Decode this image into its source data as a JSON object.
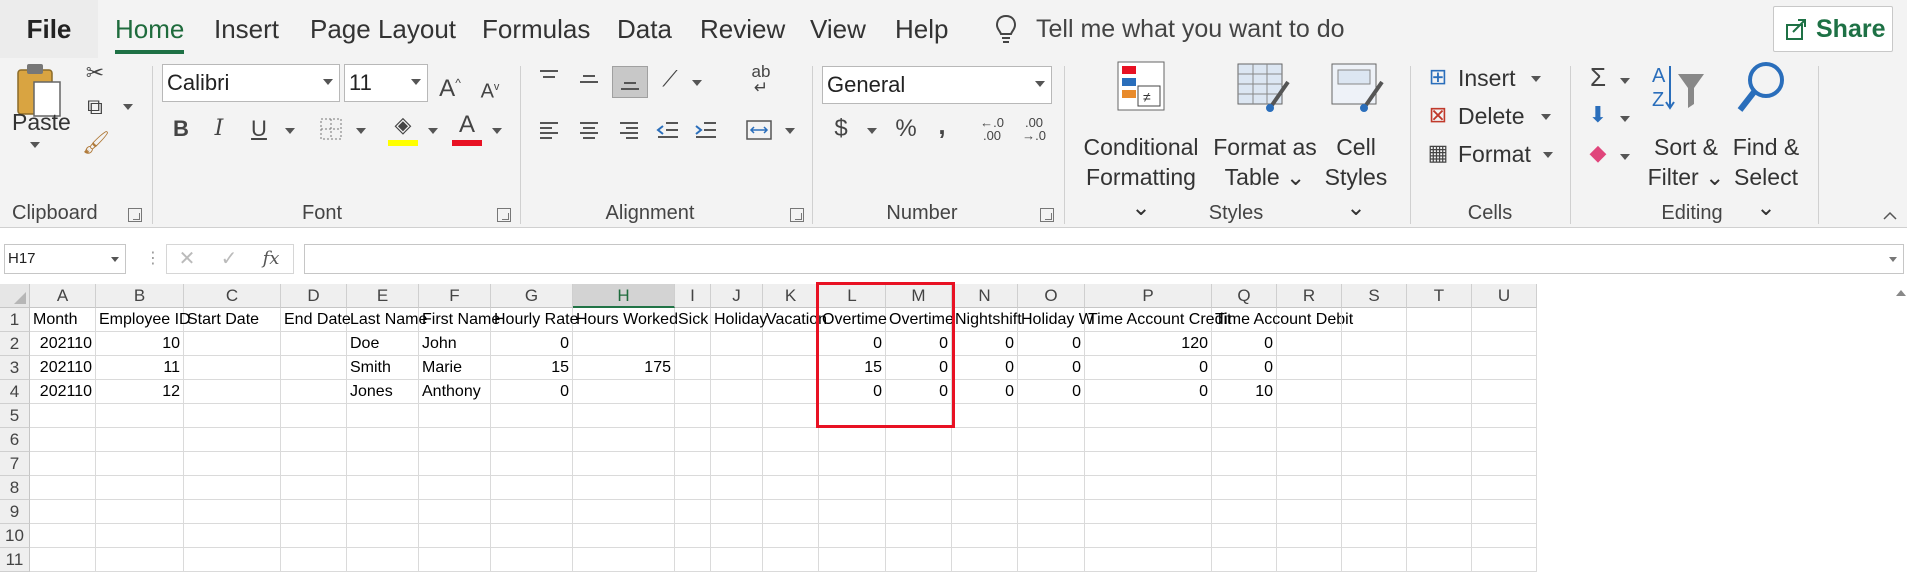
{
  "menu": {
    "file": "File",
    "tabs": [
      "Home",
      "Insert",
      "Page Layout",
      "Formulas",
      "Data",
      "Review",
      "View",
      "Help"
    ],
    "active_tab": "Home",
    "tell_me": "Tell me what you want to do",
    "share": "Share"
  },
  "ribbon": {
    "clipboard": {
      "label": "Clipboard",
      "paste": "Paste"
    },
    "font": {
      "label": "Font",
      "name": "Calibri",
      "size": "11",
      "bold": "B",
      "italic": "I",
      "underline": "U",
      "grow": "A",
      "shrink": "A",
      "font_color_letter": "A",
      "highlight_color": "#ffff00",
      "font_color": "#e81123"
    },
    "alignment": {
      "label": "Alignment",
      "wrap": "ab"
    },
    "number": {
      "label": "Number",
      "format": "General",
      "currency": "$",
      "percent": "%",
      "comma": ",",
      "inc_dec": "←.0 .00",
      "dec_dec": ".00 →.0"
    },
    "styles": {
      "label": "Styles",
      "conditional": [
        "Conditional",
        "Formatting"
      ],
      "format_table": [
        "Format as",
        "Table"
      ],
      "cell_styles": [
        "Cell",
        "Styles"
      ]
    },
    "cells": {
      "label": "Cells",
      "insert": "Insert",
      "delete": "Delete",
      "format": "Format"
    },
    "editing": {
      "label": "Editing",
      "sort": [
        "Sort &",
        "Filter"
      ],
      "find": [
        "Find &",
        "Select"
      ],
      "sigma": "Σ"
    }
  },
  "formula_bar": {
    "name_box": "H17",
    "fx": "fx",
    "cancel": "✕",
    "enter": "✓",
    "value": ""
  },
  "grid": {
    "columns": [
      "A",
      "B",
      "C",
      "D",
      "E",
      "F",
      "G",
      "H",
      "I",
      "J",
      "K",
      "L",
      "M",
      "N",
      "O",
      "P",
      "Q",
      "R",
      "S",
      "T",
      "U"
    ],
    "selected_column": "H",
    "row_numbers": [
      "1",
      "2",
      "3",
      "4",
      "5",
      "6",
      "7",
      "8",
      "9",
      "10",
      "11"
    ],
    "rows": [
      [
        "Month",
        "Employee ID",
        "Start Date",
        "End Date",
        "Last Name",
        "First Name",
        "Hourly Rate",
        "Hours Worked",
        "Sick",
        "Holiday",
        "Vacation",
        "Overtime",
        "Overtime",
        "Nightshift",
        "Holiday W",
        "Time Account Credit",
        "Time Account Debit",
        "",
        "",
        "",
        ""
      ],
      [
        "202110",
        "10",
        "",
        "",
        "Doe",
        "John",
        "0",
        "",
        "",
        "",
        "",
        "0",
        "0",
        "0",
        "0",
        "120",
        "0",
        "",
        "",
        "",
        ""
      ],
      [
        "202110",
        "11",
        "",
        "",
        "Smith",
        "Marie",
        "15",
        "175",
        "",
        "",
        "",
        "15",
        "0",
        "0",
        "0",
        "0",
        "0",
        "",
        "",
        "",
        ""
      ],
      [
        "202110",
        "12",
        "",
        "",
        "Jones",
        "Anthony",
        "0",
        "",
        "",
        "",
        "",
        "0",
        "0",
        "0",
        "0",
        "0",
        "10",
        "",
        "",
        "",
        ""
      ]
    ],
    "numeric_columns": [
      "A",
      "B",
      "G",
      "H",
      "L",
      "M",
      "N",
      "O",
      "P",
      "Q"
    ],
    "highlight_color": "#e81123"
  }
}
